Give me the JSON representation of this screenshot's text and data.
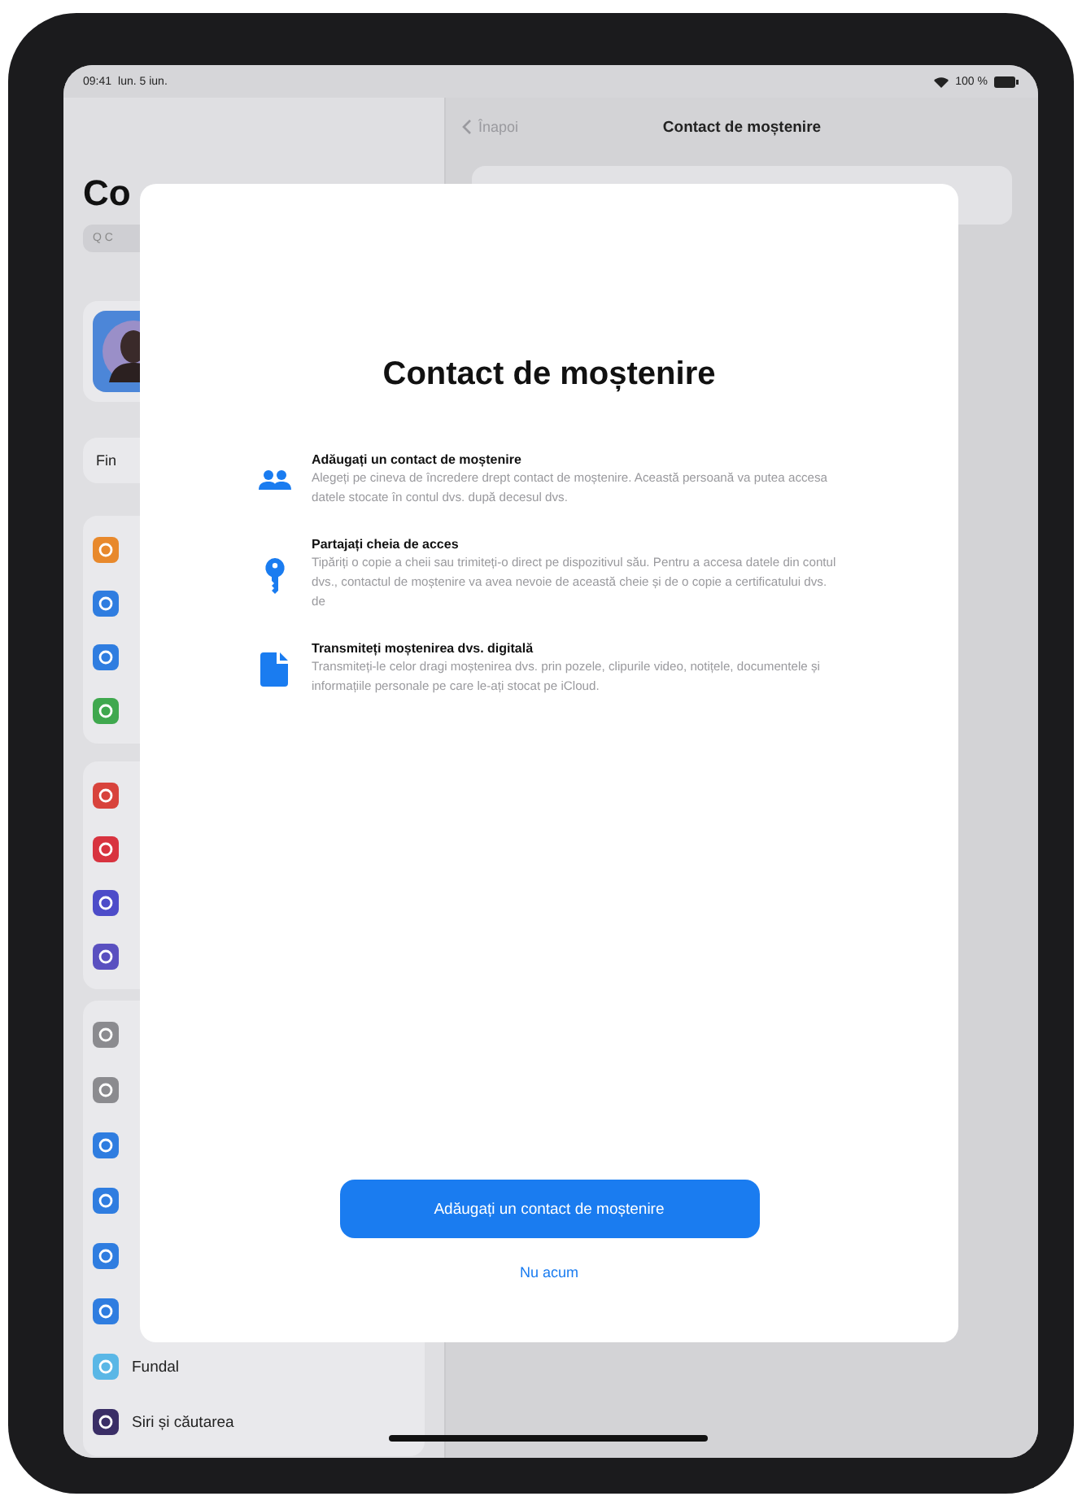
{
  "status_bar": {
    "time": "09:41",
    "date": "lun. 5 iun.",
    "battery": "100 %"
  },
  "sidebar": {
    "title": "Co",
    "search_placeholder": "Q C",
    "family_card": "Fin",
    "groups": [
      {
        "items": [
          {
            "color": "#e8892c"
          },
          {
            "color": "#2f7de0"
          },
          {
            "color": "#2f7de0"
          },
          {
            "color": "#3fa84e"
          }
        ]
      },
      {
        "items": [
          {
            "color": "#d8433c"
          },
          {
            "color": "#d8333f"
          },
          {
            "color": "#4d4cc9"
          },
          {
            "color": "#5a50c0"
          }
        ]
      },
      {
        "items": [
          {
            "color": "#8b8b8f"
          },
          {
            "color": "#8b8b8f"
          },
          {
            "color": "#2f7de0"
          },
          {
            "color": "#2f7de0"
          },
          {
            "color": "#2f7de0"
          },
          {
            "color": "#2f7de0"
          },
          {
            "color": "#5ab7e6",
            "label": "Fundal"
          },
          {
            "color": "#3a2e66",
            "label": "Siri și căutarea"
          }
        ]
      }
    ]
  },
  "navigation": {
    "back": "Înapoi",
    "title": "Contact de moștenire"
  },
  "sheet": {
    "title": "Contact de moștenire",
    "features": [
      {
        "kind": "people",
        "title": "Adăugați un contact de moștenire",
        "text": "Alegeți pe cineva de încredere drept contact de moștenire. Această persoană va putea accesa datele stocate în contul dvs. după decesul dvs."
      },
      {
        "kind": "key",
        "title": "Partajați cheia de acces",
        "text": "Tipăriți o copie a cheii sau trimiteți-o direct pe dispozitivul său. Pentru a accesa datele din contul dvs., contactul de moștenire va avea nevoie de această cheie și de o copie a certificatului dvs. de"
      },
      {
        "kind": "document",
        "title": "Transmiteți moștenirea dvs. digitală",
        "text": "Transmiteți-le celor dragi moștenirea dvs. prin pozele, clipurile video, notițele, documentele și informațiile personale pe care le-ați stocat pe iCloud."
      }
    ],
    "primary_button": "Adăugați un contact de moștenire",
    "secondary_button": "Nu acum"
  }
}
